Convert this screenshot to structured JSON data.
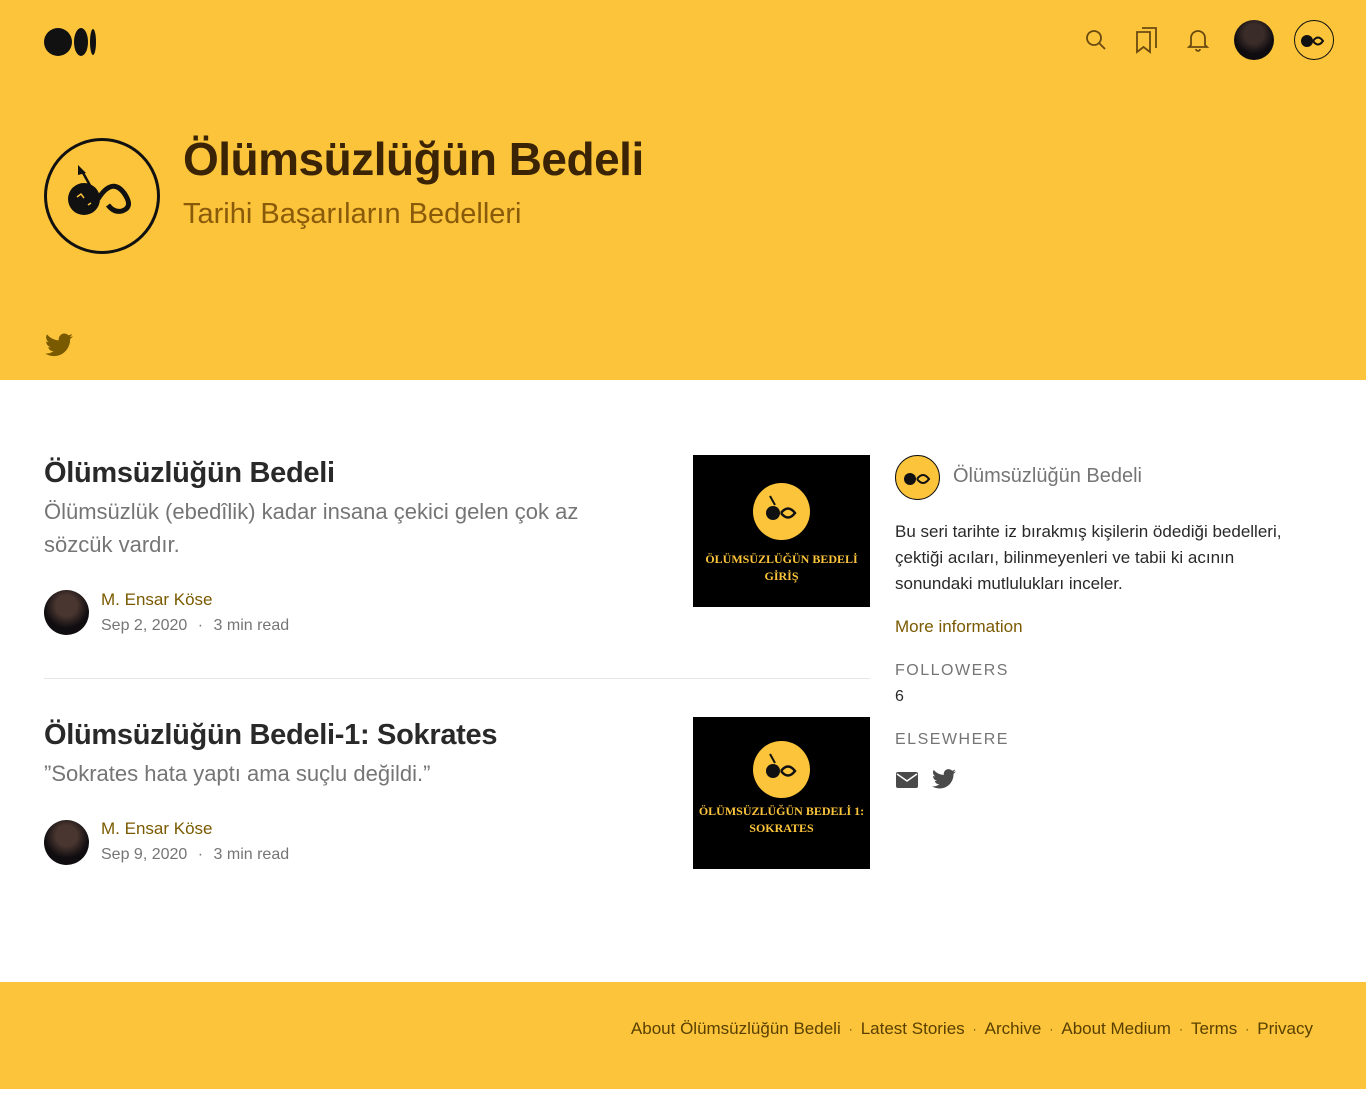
{
  "brand": {
    "accent": "#fbc43a",
    "title_color": "#3a2405",
    "tagline_color": "#8a5a0b",
    "link_color": "#7a5a00"
  },
  "publication": {
    "title": "Ölümsüzlüğün Bedeli",
    "tagline": "Tarihi Başarıların Bedelleri"
  },
  "posts": [
    {
      "title": "Ölümsüzlüğün Bedeli",
      "subtitle": "Ölümsüzlük (ebedîlik) kadar insana çekici gelen çok az sözcük vardır.",
      "author": "M. Ensar Köse",
      "date": "Sep 2, 2020",
      "read_time": "3 min read",
      "thumb_text_line1": "ÖLÜMSÜZLÜĞÜN BEDELİ",
      "thumb_text_line2": "GİRİŞ"
    },
    {
      "title": "Ölümsüzlüğün Bedeli-1: Sokrates",
      "subtitle": "”Sokrates hata yaptı ama suçlu değildi.”",
      "author": "M. Ensar Köse",
      "date": "Sep 9, 2020",
      "read_time": "3 min read",
      "thumb_text_line1": "ÖLÜMSÜZLÜĞÜN BEDELİ 1:",
      "thumb_text_line2": "SOKRATES"
    }
  ],
  "sidebar": {
    "name": "Ölümsüzlüğün Bedeli",
    "description": "Bu seri tarihte iz bırakmış kişilerin ödediği bedelleri, çektiği acıları, bilinmeyenleri ve tabii ki acının sonundaki mutlulukları inceler.",
    "more_info": "More information",
    "followers_label": "FOLLOWERS",
    "followers_count": "6",
    "elsewhere_label": "ELSEWHERE"
  },
  "meta_separator": "·",
  "footer": {
    "links": [
      "About Ölümsüzlüğün Bedeli",
      "Latest Stories",
      "Archive",
      "About Medium",
      "Terms",
      "Privacy"
    ],
    "separator": "·"
  },
  "icons": {
    "logo": "medium-logo-icon",
    "search": "search-icon",
    "bookmarks": "bookmarks-icon",
    "notifications": "bell-icon",
    "twitter": "twitter-icon",
    "mail": "mail-icon"
  }
}
